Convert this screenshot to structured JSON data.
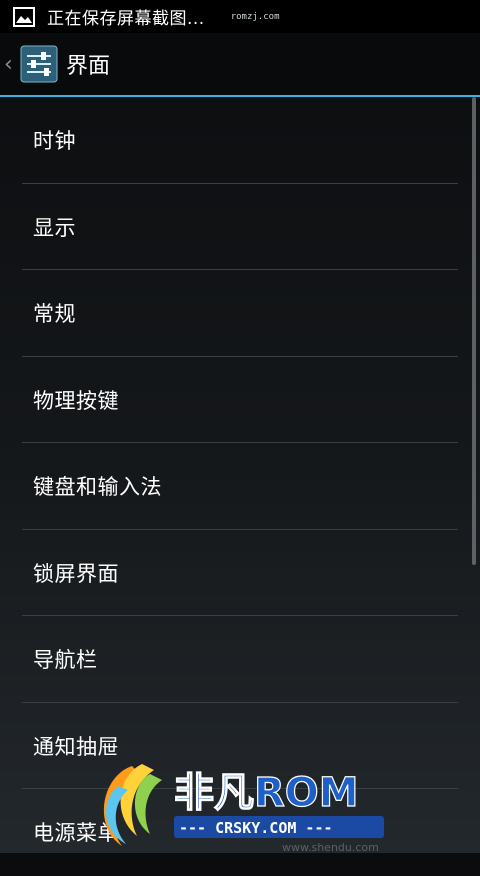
{
  "statusbar": {
    "icon": "image-icon",
    "text": "正在保存屏幕截图...",
    "watermark": "romzj.com"
  },
  "actionbar": {
    "back_icon": "chevron-left-icon",
    "app_icon": "settings-sliders-icon",
    "title": "界面",
    "accent_color": "#33b5e5"
  },
  "list": {
    "items": [
      {
        "label": "时钟"
      },
      {
        "label": "显示"
      },
      {
        "label": "常规"
      },
      {
        "label": "物理按键"
      },
      {
        "label": "键盘和输入法"
      },
      {
        "label": "锁屏界面"
      },
      {
        "label": "导航栏"
      },
      {
        "label": "通知抽屉"
      },
      {
        "label": "电源菜单"
      }
    ]
  },
  "overlay": {
    "logo_text": "非凡ROM",
    "logo_sub": "--- CRSKY.COM ---",
    "watermark_url": "www.shendu.com"
  }
}
